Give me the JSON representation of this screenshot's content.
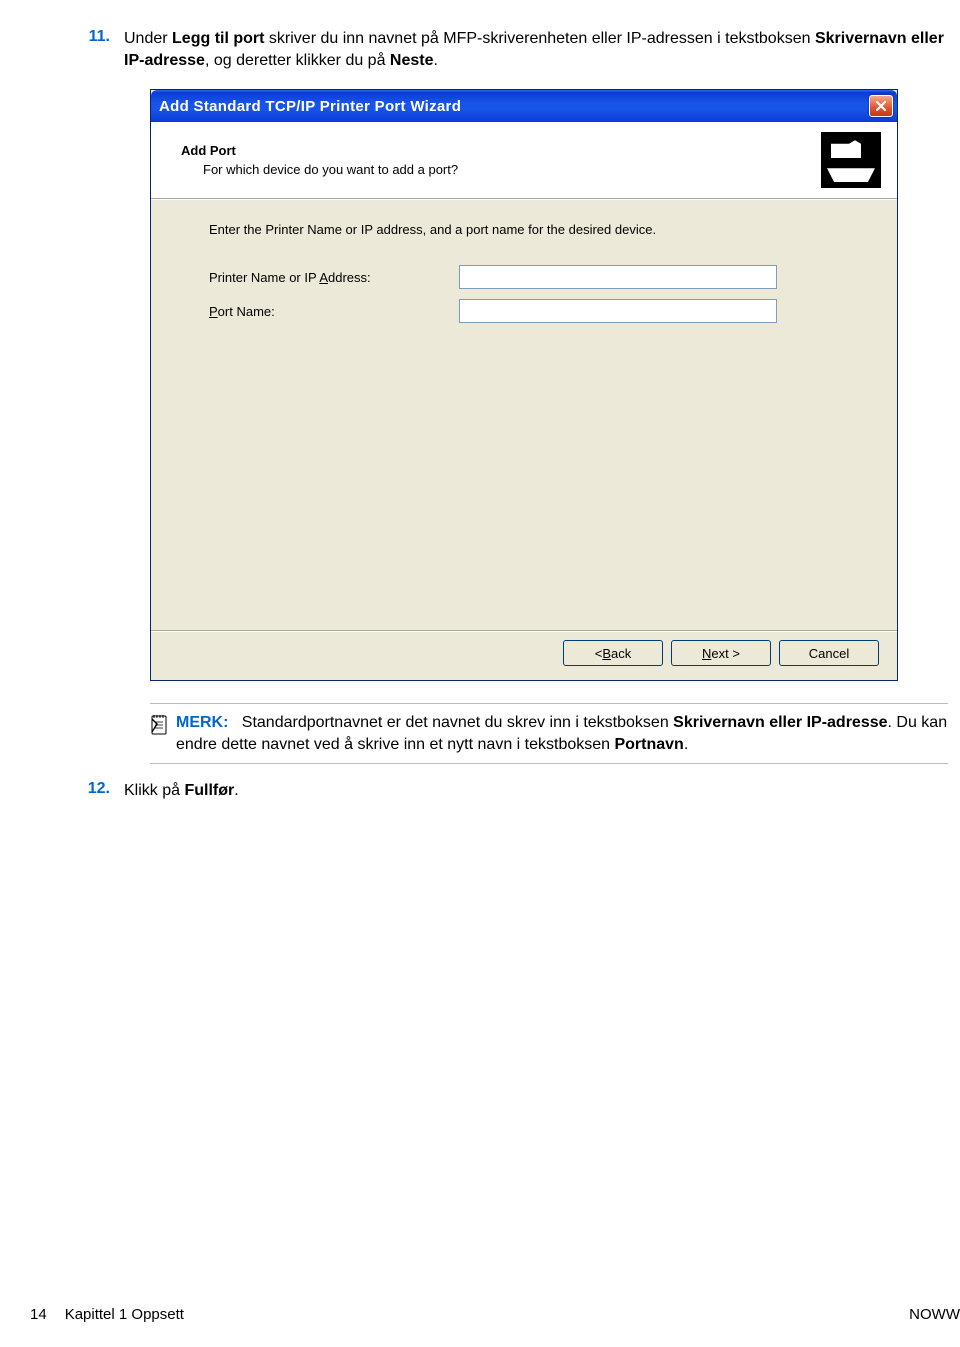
{
  "step11": {
    "num": "11.",
    "pre": "Under ",
    "bold1": "Legg til port",
    "mid1": " skriver du inn navnet på MFP-skriverenheten eller IP-adressen i tekstboksen ",
    "bold2": "Skrivernavn eller IP-adresse",
    "mid2": ", og deretter klikker du på ",
    "bold3": "Neste",
    "end": "."
  },
  "dialog": {
    "title": "Add Standard TCP/IP Printer Port Wizard",
    "header_title": "Add Port",
    "header_sub": "For which device do you want to add a port?",
    "instruction": "Enter the Printer Name or IP address, and a port name for the desired device.",
    "label_printer_p1": "Printer Name or IP ",
    "label_printer_u": "A",
    "label_printer_p2": "ddress:",
    "label_port_u": "P",
    "label_port_p2": "ort Name:",
    "val_printer": "",
    "val_port": "",
    "btn_back_lt": "< ",
    "btn_back_u": "B",
    "btn_back_t": "ack",
    "btn_next_u": "N",
    "btn_next_t": "ext >",
    "btn_cancel": "Cancel"
  },
  "note": {
    "label": "MERK:",
    "space": "    ",
    "t1": "Standardportnavnet er det navnet du skrev inn i tekstboksen ",
    "b1": "Skrivernavn eller IP-adresse",
    "t2": ". Du kan endre dette navnet ved å skrive inn et nytt navn i tekstboksen ",
    "b2": "Portnavn",
    "t3": "."
  },
  "step12": {
    "num": "12.",
    "t1": "Klikk på ",
    "b1": "Fullfør",
    "t2": "."
  },
  "footer": {
    "page": "14",
    "chapter": "Kapittel 1   Oppsett",
    "right": "NOWW"
  }
}
